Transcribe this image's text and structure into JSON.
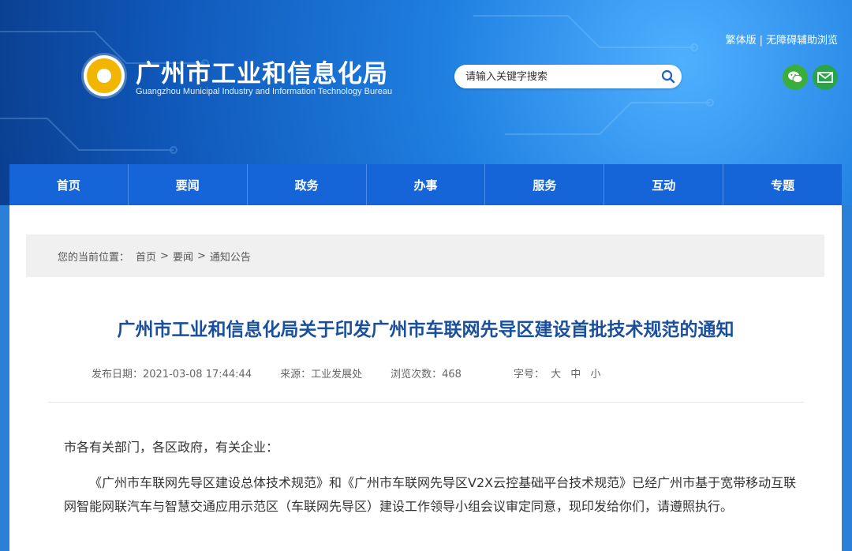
{
  "header": {
    "title": "广州市工业和信息化局",
    "subtitle": "Guangzhou Municipal Industry and Information Technology Bureau",
    "top_links": [
      "繁体版",
      "无障碍辅助浏览"
    ],
    "search_placeholder": "请输入关键字搜索",
    "icons": [
      "wechat-icon",
      "mail-icon",
      "search-icon"
    ]
  },
  "nav": {
    "items": [
      "首页",
      "要闻",
      "政务",
      "办事",
      "服务",
      "互动",
      "专题"
    ]
  },
  "breadcrumb": {
    "label": "您的当前位置：",
    "items": [
      "首页",
      "要闻",
      "通知公告"
    ],
    "separator": ">"
  },
  "article": {
    "title": "广州市工业和信息化局关于印发广州市车联网先导区建设首批技术规范的通知",
    "date_label": "发布日期：",
    "date": "2021-03-08 17:44:44",
    "source_label": "来源：",
    "source": "工业发展处",
    "views_label": "浏览次数：",
    "views": "468",
    "fontsize_label": "字号：",
    "fontsizes": [
      "大",
      "中",
      "小"
    ],
    "greeting": "市各有关部门，各区政府，有关企业：",
    "paragraph": "《广州市车联网先导区建设总体技术规范》和《广州市车联网先导区V2X云控基础平台技术规范》已经广州市基于宽带移动互联网智能网联汽车与智慧交通应用示范区（车联网先导区）建设工作领导小组会议审定同意，现印发给你们，请遵照执行。"
  },
  "colors": {
    "nav_bg": "#1565d8",
    "title": "#1a4f9c",
    "banner": "#1f7fe0"
  }
}
